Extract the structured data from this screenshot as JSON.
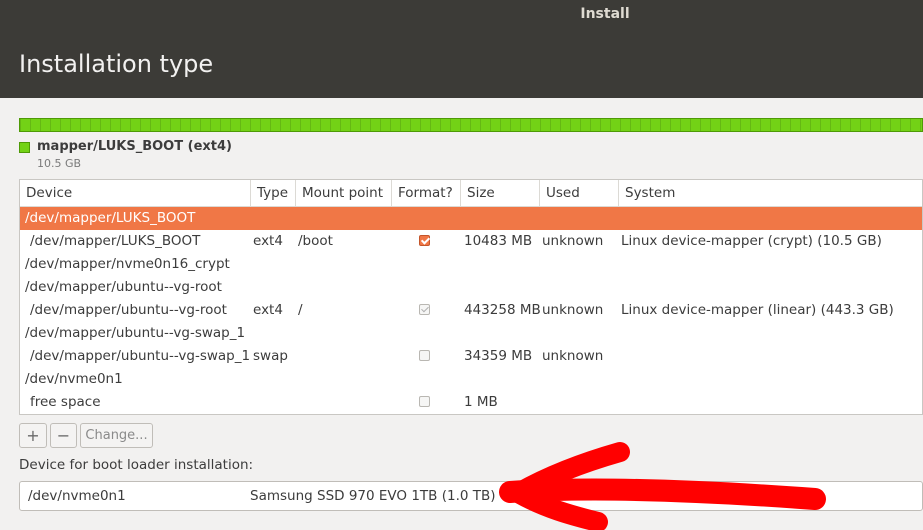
{
  "window": {
    "title": "Install"
  },
  "page": {
    "title": "Installation type"
  },
  "partition_legend": {
    "label": "mapper/LUKS_BOOT (ext4)",
    "size": "10.5 GB",
    "color": "#73d216"
  },
  "table": {
    "headers": [
      "Device",
      "Type",
      "Mount point",
      "Format?",
      "Size",
      "Used",
      "System"
    ],
    "rows": [
      {
        "device": "/dev/mapper/LUKS_BOOT",
        "type": "",
        "mount": "",
        "format": "none",
        "size": "",
        "used": "",
        "system": "",
        "indent": false,
        "selected": true
      },
      {
        "device": "/dev/mapper/LUKS_BOOT",
        "type": "ext4",
        "mount": "/boot",
        "format": "checked",
        "size": "10483 MB",
        "used": "unknown",
        "system": "Linux device-mapper (crypt) (10.5 GB)",
        "indent": true,
        "selected": false
      },
      {
        "device": "/dev/mapper/nvme0n16_crypt",
        "type": "",
        "mount": "",
        "format": "none",
        "size": "",
        "used": "",
        "system": "",
        "indent": false,
        "selected": false
      },
      {
        "device": "/dev/mapper/ubuntu--vg-root",
        "type": "",
        "mount": "",
        "format": "none",
        "size": "",
        "used": "",
        "system": "",
        "indent": false,
        "selected": false
      },
      {
        "device": "/dev/mapper/ubuntu--vg-root",
        "type": "ext4",
        "mount": "/",
        "format": "checked-disabled",
        "size": "443258 MB",
        "used": "unknown",
        "system": "Linux device-mapper (linear) (443.3 GB)",
        "indent": true,
        "selected": false
      },
      {
        "device": "/dev/mapper/ubuntu--vg-swap_1",
        "type": "",
        "mount": "",
        "format": "none",
        "size": "",
        "used": "",
        "system": "",
        "indent": false,
        "selected": false
      },
      {
        "device": "/dev/mapper/ubuntu--vg-swap_1",
        "type": "swap",
        "mount": "",
        "format": "unchecked-disabled",
        "size": "34359 MB",
        "used": "unknown",
        "system": "",
        "indent": true,
        "selected": false
      },
      {
        "device": "/dev/nvme0n1",
        "type": "",
        "mount": "",
        "format": "none",
        "size": "",
        "used": "",
        "system": "",
        "indent": false,
        "selected": false
      },
      {
        "device": "free space",
        "type": "",
        "mount": "",
        "format": "unchecked-disabled",
        "size": "1 MB",
        "used": "",
        "system": "",
        "indent": true,
        "selected": false
      }
    ]
  },
  "buttons": {
    "add": "+",
    "remove": "−",
    "change": "Change..."
  },
  "boot_loader": {
    "label": "Device for boot loader installation:",
    "device": "/dev/nvme0n1",
    "description": "Samsung SSD 970 EVO 1TB (1.0 TB)"
  },
  "colors": {
    "accent": "#f07746",
    "titlebar": "#3c3b37",
    "annotation": "#ff0000"
  },
  "icons": {
    "annotation": "red-arrow-annotation"
  }
}
